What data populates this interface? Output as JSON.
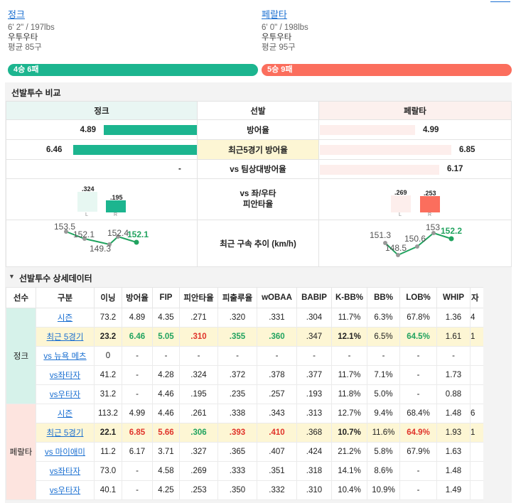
{
  "pitchers": {
    "a": {
      "name": "정크",
      "size": "6' 2\" / 197lbs",
      "hand": "우투우타",
      "avg_pitches": "평균 85구",
      "record": "4승 6패"
    },
    "b": {
      "name": "페랄타",
      "size": "6' 0\" / 198lbs",
      "hand": "우투우타",
      "avg_pitches": "평균 95구",
      "record": "5승 9패"
    }
  },
  "compare": {
    "title": "선발투수 비교",
    "header": {
      "a": "정크",
      "mid": "선발",
      "b": "페랄타"
    },
    "rows": [
      {
        "label": "방어율",
        "a": "4.89",
        "b": "4.99"
      },
      {
        "label": "최근5경기 방어율",
        "a": "6.46",
        "b": "6.85"
      },
      {
        "label": "vs 팀상대방어율",
        "a": "-",
        "b": "6.17"
      }
    ],
    "split_label": "vs 좌/우타\n피안타율",
    "split": {
      "a": {
        "L": ".324",
        "R": ".195"
      },
      "b": {
        "L": ".269",
        "R": ".253"
      },
      "l_label": "L",
      "r_label": "R"
    },
    "velo_label": "최근 구속 추이 (km/h)",
    "velo": {
      "a": [
        "153.5",
        "152.1",
        "149.3",
        "152.4",
        "152.1"
      ],
      "b": [
        "151.3",
        "148.5",
        "150.6",
        "153",
        "152.2"
      ]
    }
  },
  "detail": {
    "title": "선발투수 상세데이터",
    "columns": [
      "선수",
      "구분",
      "이닝",
      "방어율",
      "FIP",
      "피안타율",
      "피출루율",
      "wOBAA",
      "BABIP",
      "K-BB%",
      "BB%",
      "LOB%",
      "WHIP",
      "자"
    ],
    "groups": [
      {
        "player": "정크",
        "rows": [
          {
            "sub": "시즌",
            "vals": [
              "73.2",
              "4.89",
              "4.35",
              ".271",
              ".320",
              ".331",
              ".304",
              "11.7%",
              "6.3%",
              "67.8%",
              "1.36",
              "4"
            ]
          },
          {
            "sub": "최근 5경기",
            "hl": true,
            "vals": [
              "23.2",
              "6.46",
              "5.05",
              ".310",
              ".355",
              ".360",
              ".347",
              "12.1%",
              "6.5%",
              "64.5%",
              "1.61",
              "1"
            ]
          },
          {
            "sub": "vs 뉴욕 메츠",
            "vals": [
              "0",
              "-",
              "-",
              "-",
              "-",
              "-",
              "-",
              "-",
              "-",
              "-",
              "-",
              ""
            ]
          },
          {
            "sub": "vs좌타자",
            "vals": [
              "41.2",
              "-",
              "4.28",
              ".324",
              ".372",
              ".378",
              ".377",
              "11.7%",
              "7.1%",
              "-",
              "1.73",
              ""
            ]
          },
          {
            "sub": "vs우타자",
            "vals": [
              "31.2",
              "-",
              "4.46",
              ".195",
              ".235",
              ".257",
              ".193",
              "11.8%",
              "5.0%",
              "-",
              "0.88",
              ""
            ]
          }
        ]
      },
      {
        "player": "페랄타",
        "rows": [
          {
            "sub": "시즌",
            "vals": [
              "113.2",
              "4.99",
              "4.46",
              ".261",
              ".338",
              ".343",
              ".313",
              "12.7%",
              "9.4%",
              "68.4%",
              "1.48",
              "6"
            ]
          },
          {
            "sub": "최근 5경기",
            "hl": true,
            "vals": [
              "22.1",
              "6.85",
              "5.66",
              ".306",
              ".393",
              ".410",
              ".368",
              "10.7%",
              "11.6%",
              "64.9%",
              "1.93",
              "1"
            ]
          },
          {
            "sub": "vs 마이애미",
            "vals": [
              "11.2",
              "6.17",
              "3.71",
              ".327",
              ".365",
              ".407",
              ".424",
              "21.2%",
              "5.8%",
              "67.9%",
              "1.63",
              ""
            ]
          },
          {
            "sub": "vs좌타자",
            "vals": [
              "73.0",
              "-",
              "4.58",
              ".269",
              ".333",
              ".351",
              ".318",
              "14.1%",
              "8.6%",
              "-",
              "1.48",
              ""
            ]
          },
          {
            "sub": "vs우타자",
            "vals": [
              "40.1",
              "-",
              "4.25",
              ".253",
              ".350",
              ".332",
              ".310",
              "10.4%",
              "10.9%",
              "-",
              "1.49",
              ""
            ]
          }
        ]
      }
    ]
  },
  "colors": {
    "teamA": "#1cb58f",
    "teamB": "#fb6e5d",
    "green": "#21a35f",
    "red": "#e0332a",
    "link": "#1a6fd1"
  }
}
